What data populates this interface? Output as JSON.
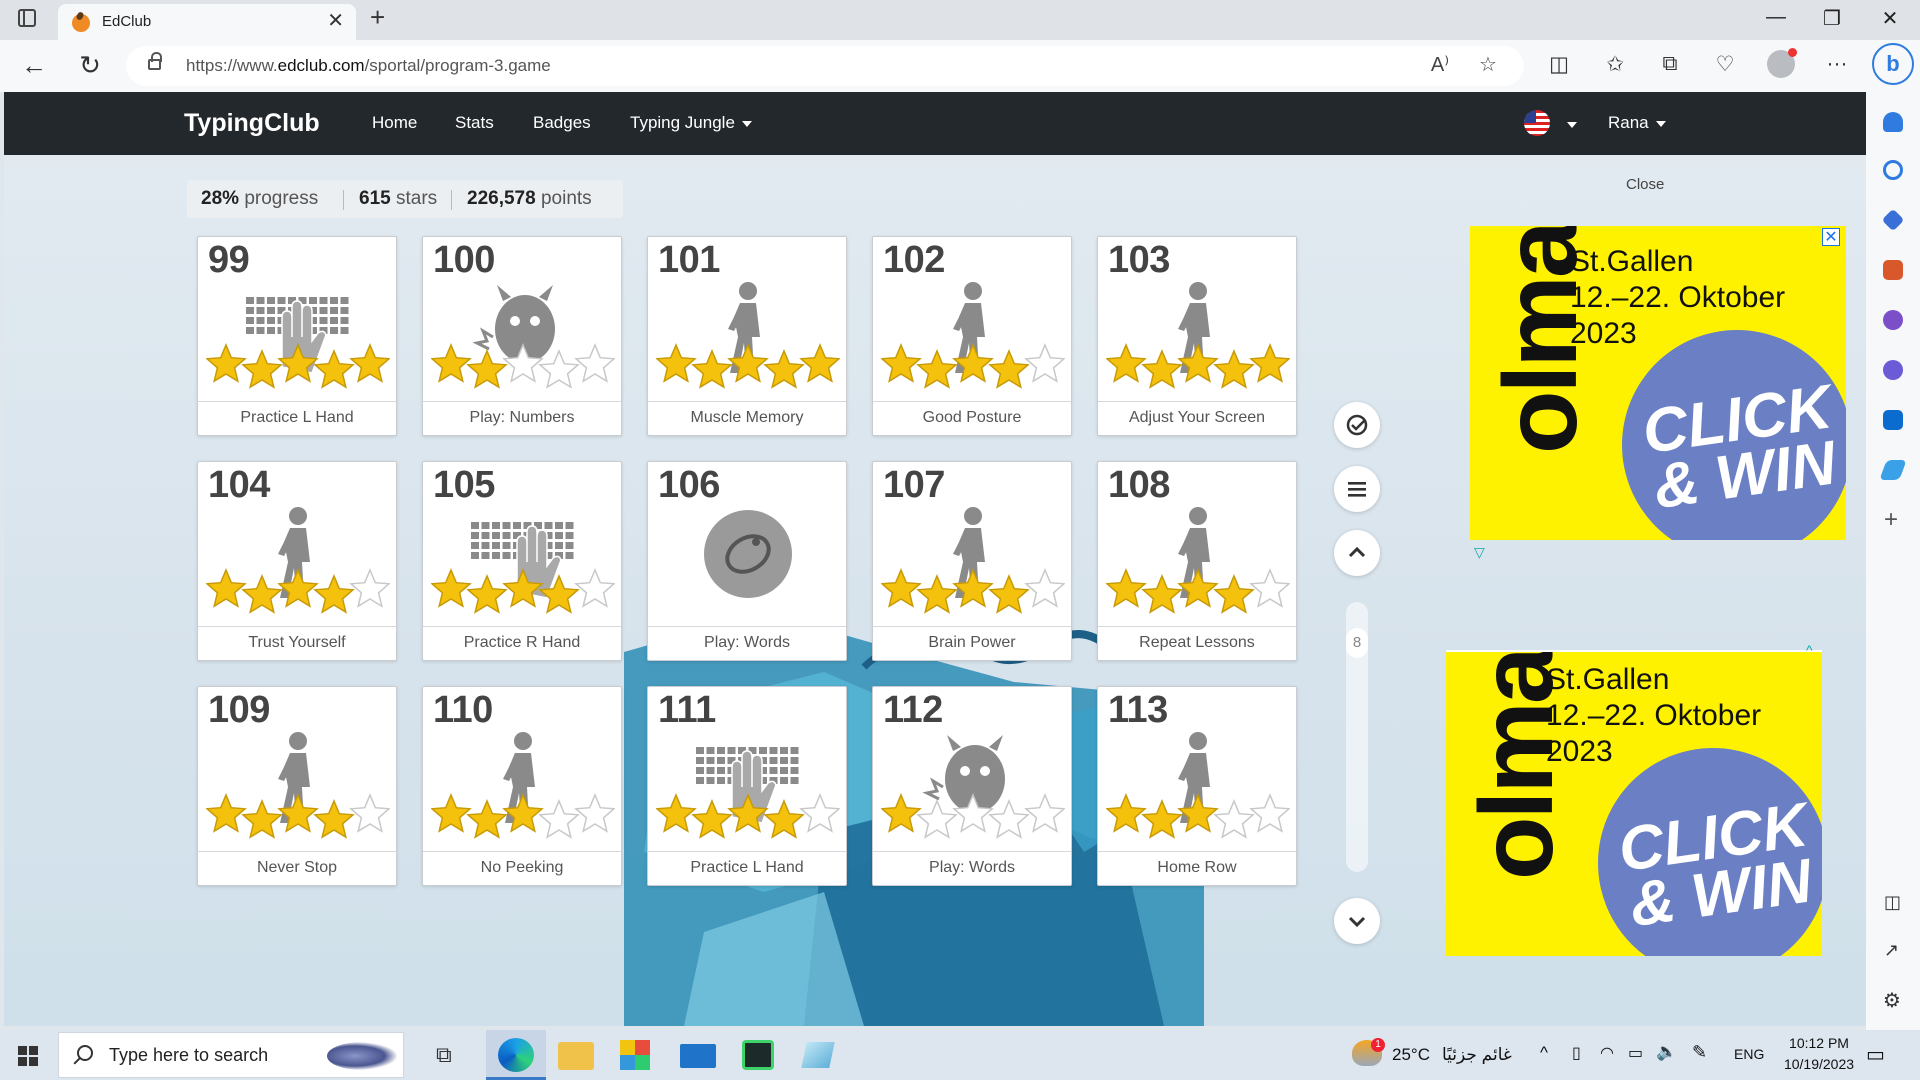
{
  "browser": {
    "tab_title": "EdClub",
    "url_prefix": "https://www.",
    "url_host": "edclub.com",
    "url_path": "/sportal/program-3.game"
  },
  "site": {
    "brand": "TypingClub",
    "nav": [
      "Home",
      "Stats",
      "Badges",
      "Typing Jungle"
    ],
    "user": "Rana"
  },
  "progress": {
    "percent": "28%",
    "percent_label": "progress",
    "stars": "615",
    "stars_label": "stars",
    "points": "226,578",
    "points_label": "points"
  },
  "lessons": [
    {
      "num": "99",
      "label": "Practice L Hand",
      "icon": "keyboard-left-hand-icon",
      "stars": 5,
      "max_stars": 5
    },
    {
      "num": "100",
      "label": "Play: Numbers",
      "icon": "monster-game-icon",
      "stars": 2,
      "max_stars": 5
    },
    {
      "num": "101",
      "label": "Muscle Memory",
      "icon": "walking-man-icon",
      "stars": 5,
      "max_stars": 5
    },
    {
      "num": "102",
      "label": "Good Posture",
      "icon": "walking-man-icon",
      "stars": 4,
      "max_stars": 5
    },
    {
      "num": "103",
      "label": "Adjust Your Screen",
      "icon": "walking-man-icon",
      "stars": 5,
      "max_stars": 5
    },
    {
      "num": "104",
      "label": "Trust Yourself",
      "icon": "walking-man-icon",
      "stars": 4,
      "max_stars": 5
    },
    {
      "num": "105",
      "label": "Practice R Hand",
      "icon": "keyboard-right-hand-icon",
      "stars": 4,
      "max_stars": 5
    },
    {
      "num": "106",
      "label": "Play: Words",
      "icon": "bird-game-icon",
      "stars": 0,
      "max_stars": 0
    },
    {
      "num": "107",
      "label": "Brain Power",
      "icon": "walking-man-icon",
      "stars": 4,
      "max_stars": 5
    },
    {
      "num": "108",
      "label": "Repeat Lessons",
      "icon": "walking-man-icon",
      "stars": 4,
      "max_stars": 5
    },
    {
      "num": "109",
      "label": "Never Stop",
      "icon": "walking-man-icon",
      "stars": 4,
      "max_stars": 5
    },
    {
      "num": "110",
      "label": "No Peeking",
      "icon": "walking-man-icon",
      "stars": 3,
      "max_stars": 5
    },
    {
      "num": "111",
      "label": "Practice L Hand",
      "icon": "keyboard-left-hand-icon",
      "stars": 4,
      "max_stars": 5
    },
    {
      "num": "112",
      "label": "Play: Words",
      "icon": "monster-game-icon",
      "stars": 1,
      "max_stars": 5
    },
    {
      "num": "113",
      "label": "Home Row",
      "icon": "walking-man-icon",
      "stars": 3,
      "max_stars": 5
    }
  ],
  "controls": {
    "page_number": "8"
  },
  "ads": {
    "close_label": "Close",
    "brand": "olma",
    "line1": "St.Gallen",
    "line2": "12.–22. Oktober",
    "line3": "2023",
    "cta1": "CLICK",
    "cta2": "& WIN"
  },
  "taskbar": {
    "search_placeholder": "Type here to search",
    "weather_temp": "25°C",
    "weather_desc": "غائم جزئيًا",
    "weather_badge": "1",
    "lang": "ENG",
    "time": "10:12 PM",
    "date": "10/19/2023"
  },
  "colors": {
    "nav_bg": "#23282d",
    "star_gold": "#f4c20d",
    "ad_yellow": "#fff200",
    "ad_blue": "#6a7fc4",
    "edge_blue": "#2f7be0"
  }
}
